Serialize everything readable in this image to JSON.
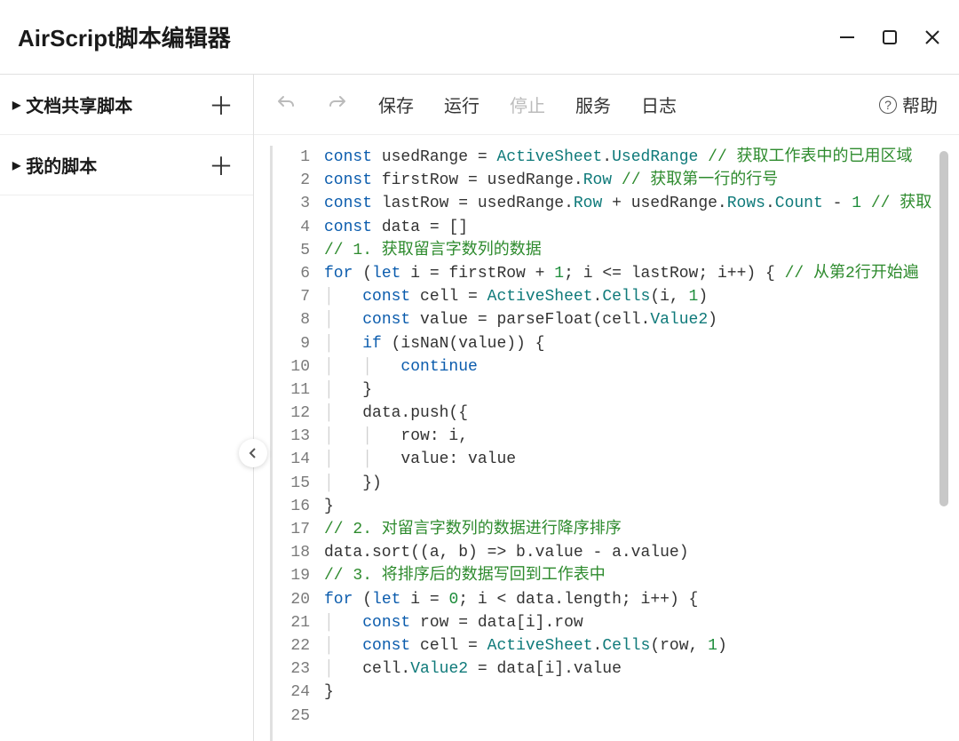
{
  "title": "AirScript脚本编辑器",
  "sidebar": {
    "items": [
      {
        "label": "文档共享脚本"
      },
      {
        "label": "我的脚本"
      }
    ]
  },
  "toolbar": {
    "save": "保存",
    "run": "运行",
    "stop": "停止",
    "service": "服务",
    "log": "日志",
    "help": "帮助"
  },
  "editor": {
    "lineStart": 1,
    "lineCount": 25,
    "lines": [
      [
        [
          "kw",
          "const"
        ],
        [
          "pl",
          " usedRange "
        ],
        [
          "op",
          "="
        ],
        [
          "pl",
          " "
        ],
        [
          "id",
          "ActiveSheet"
        ],
        [
          "op",
          "."
        ],
        [
          "id",
          "UsedRange"
        ],
        [
          "pl",
          " "
        ],
        [
          "cm",
          "// 获取工作表中的已用区域"
        ]
      ],
      [
        [
          "kw",
          "const"
        ],
        [
          "pl",
          " firstRow "
        ],
        [
          "op",
          "="
        ],
        [
          "pl",
          " usedRange."
        ],
        [
          "id",
          "Row"
        ],
        [
          "pl",
          " "
        ],
        [
          "cm",
          "// 获取第一行的行号"
        ]
      ],
      [
        [
          "kw",
          "const"
        ],
        [
          "pl",
          " lastRow "
        ],
        [
          "op",
          "="
        ],
        [
          "pl",
          " usedRange."
        ],
        [
          "id",
          "Row"
        ],
        [
          "pl",
          " "
        ],
        [
          "op",
          "+"
        ],
        [
          "pl",
          " usedRange."
        ],
        [
          "id",
          "Rows"
        ],
        [
          "op",
          "."
        ],
        [
          "id",
          "Count"
        ],
        [
          "pl",
          " "
        ],
        [
          "op",
          "-"
        ],
        [
          "pl",
          " "
        ],
        [
          "num",
          "1"
        ],
        [
          "pl",
          " "
        ],
        [
          "cm",
          "// 获取"
        ]
      ],
      [
        [
          "kw",
          "const"
        ],
        [
          "pl",
          " data "
        ],
        [
          "op",
          "="
        ],
        [
          "pl",
          " []"
        ]
      ],
      [
        [
          "cm",
          "// 1. 获取留言字数列的数据"
        ]
      ],
      [
        [
          "kw",
          "for"
        ],
        [
          "pl",
          " ("
        ],
        [
          "kw",
          "let"
        ],
        [
          "pl",
          " i "
        ],
        [
          "op",
          "="
        ],
        [
          "pl",
          " firstRow "
        ],
        [
          "op",
          "+"
        ],
        [
          "pl",
          " "
        ],
        [
          "num",
          "1"
        ],
        [
          "pl",
          "; i "
        ],
        [
          "op",
          "<="
        ],
        [
          "pl",
          " lastRow; i"
        ],
        [
          "op",
          "++"
        ],
        [
          "pl",
          ") { "
        ],
        [
          "cm",
          "// 从第2行开始遍"
        ]
      ],
      [
        [
          "guide",
          "    "
        ],
        [
          "kw",
          "const"
        ],
        [
          "pl",
          " cell "
        ],
        [
          "op",
          "="
        ],
        [
          "pl",
          " "
        ],
        [
          "id",
          "ActiveSheet"
        ],
        [
          "op",
          "."
        ],
        [
          "id",
          "Cells"
        ],
        [
          "pl",
          "(i, "
        ],
        [
          "num",
          "1"
        ],
        [
          "pl",
          ")"
        ]
      ],
      [
        [
          "guide",
          "    "
        ],
        [
          "kw",
          "const"
        ],
        [
          "pl",
          " value "
        ],
        [
          "op",
          "="
        ],
        [
          "pl",
          " parseFloat(cell."
        ],
        [
          "id",
          "Value2"
        ],
        [
          "pl",
          ")"
        ]
      ],
      [
        [
          "guide",
          "    "
        ],
        [
          "kw",
          "if"
        ],
        [
          "pl",
          " (isNaN(value)) {"
        ]
      ],
      [
        [
          "guide",
          "        "
        ],
        [
          "kw",
          "continue"
        ]
      ],
      [
        [
          "guide",
          "    "
        ],
        [
          "pl",
          "}"
        ]
      ],
      [
        [
          "guide",
          "    "
        ],
        [
          "pl",
          "data.push({"
        ]
      ],
      [
        [
          "guide",
          "        "
        ],
        [
          "pl",
          "row: i,"
        ]
      ],
      [
        [
          "guide",
          "        "
        ],
        [
          "pl",
          "value: value"
        ]
      ],
      [
        [
          "guide",
          "    "
        ],
        [
          "pl",
          "})"
        ]
      ],
      [
        [
          "pl",
          "}"
        ]
      ],
      [
        [
          "cm",
          "// 2. 对留言字数列的数据进行降序排序"
        ]
      ],
      [
        [
          "pl",
          "data.sort((a, b) "
        ],
        [
          "op",
          "=>"
        ],
        [
          "pl",
          " b.value "
        ],
        [
          "op",
          "-"
        ],
        [
          "pl",
          " a.value)"
        ]
      ],
      [
        [
          "cm",
          "// 3. 将排序后的数据写回到工作表中"
        ]
      ],
      [
        [
          "kw",
          "for"
        ],
        [
          "pl",
          " ("
        ],
        [
          "kw",
          "let"
        ],
        [
          "pl",
          " i "
        ],
        [
          "op",
          "="
        ],
        [
          "pl",
          " "
        ],
        [
          "num",
          "0"
        ],
        [
          "pl",
          "; i "
        ],
        [
          "op",
          "<"
        ],
        [
          "pl",
          " data.length; i"
        ],
        [
          "op",
          "++"
        ],
        [
          "pl",
          ") {"
        ]
      ],
      [
        [
          "guide",
          "    "
        ],
        [
          "kw",
          "const"
        ],
        [
          "pl",
          " row "
        ],
        [
          "op",
          "="
        ],
        [
          "pl",
          " data[i].row"
        ]
      ],
      [
        [
          "guide",
          "    "
        ],
        [
          "kw",
          "const"
        ],
        [
          "pl",
          " cell "
        ],
        [
          "op",
          "="
        ],
        [
          "pl",
          " "
        ],
        [
          "id",
          "ActiveSheet"
        ],
        [
          "op",
          "."
        ],
        [
          "id",
          "Cells"
        ],
        [
          "pl",
          "(row, "
        ],
        [
          "num",
          "1"
        ],
        [
          "pl",
          ")"
        ]
      ],
      [
        [
          "guide",
          "    "
        ],
        [
          "pl",
          "cell."
        ],
        [
          "id",
          "Value2"
        ],
        [
          "pl",
          " "
        ],
        [
          "op",
          "="
        ],
        [
          "pl",
          " data[i].value"
        ]
      ],
      [
        [
          "pl",
          "}"
        ]
      ],
      [
        [
          "pl",
          ""
        ]
      ]
    ]
  }
}
